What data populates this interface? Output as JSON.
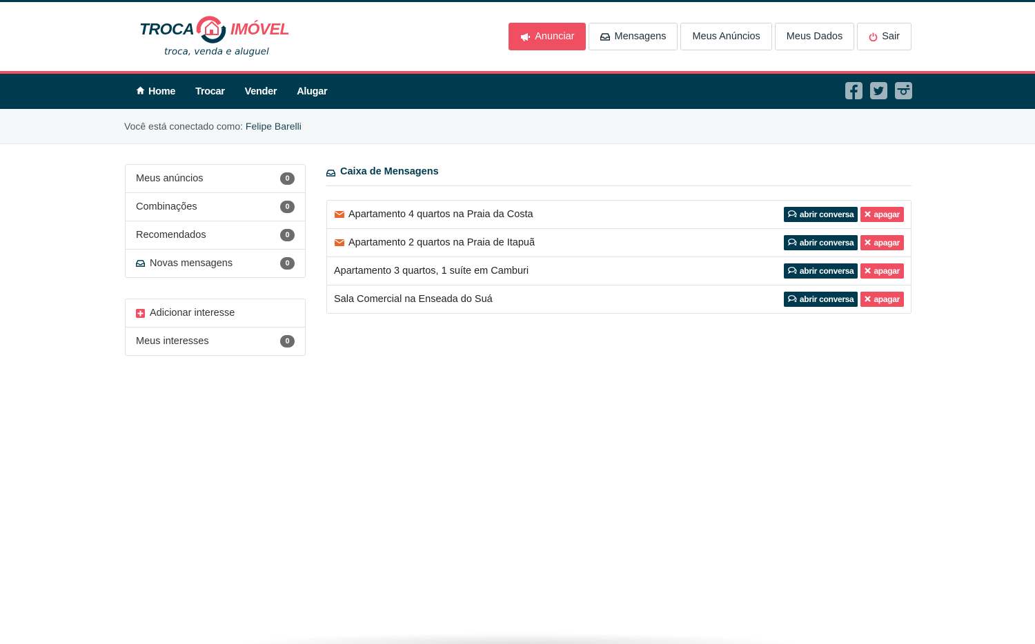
{
  "brand": {
    "word_left": "TROCA",
    "word_right": "IMÓVEL",
    "tagline": "troca, venda e aluguel",
    "colors": {
      "navy": "#003a4e",
      "pink": "#f04e61"
    }
  },
  "header": {
    "actions": [
      {
        "label": "Anunciar",
        "icon": "megaphone-icon",
        "primary": true
      },
      {
        "label": "Mensagens",
        "icon": "inbox-icon"
      },
      {
        "label": "Meus Anúncios"
      },
      {
        "label": "Meus Dados"
      },
      {
        "label": "Sair",
        "icon": "power-icon"
      }
    ]
  },
  "nav": {
    "links": [
      {
        "label": "Home",
        "icon": "home-icon"
      },
      {
        "label": "Trocar"
      },
      {
        "label": "Vender"
      },
      {
        "label": "Alugar"
      }
    ],
    "social": [
      "facebook-icon",
      "twitter-icon",
      "instagram-icon"
    ]
  },
  "session": {
    "prefix": "Você está conectado como:",
    "user": "Felipe Barelli"
  },
  "sidebar": {
    "group1": [
      {
        "label": "Meus anúncios",
        "count": "0"
      },
      {
        "label": "Combinações",
        "count": "0"
      },
      {
        "label": "Recomendados",
        "count": "0"
      },
      {
        "label": "Novas mensagens",
        "count": "0",
        "icon": "inbox-icon"
      }
    ],
    "group2": [
      {
        "label": "Adicionar interesse",
        "icon": "plus-square-icon"
      },
      {
        "label": "Meus interesses",
        "count": "0"
      }
    ]
  },
  "inbox": {
    "title": "Caixa de Mensagens",
    "open_label": "abrir conversa",
    "delete_label": "apagar",
    "messages": [
      {
        "subject": "Apartamento 4 quartos na Praia da Costa",
        "unread": true
      },
      {
        "subject": "Apartamento 2 quartos na Praia de Itapuã",
        "unread": true
      },
      {
        "subject": "Apartamento 3 quartos, 1 suíte em Camburi",
        "unread": false
      },
      {
        "subject": "Sala Comercial na Enseada do Suá",
        "unread": false
      }
    ]
  }
}
